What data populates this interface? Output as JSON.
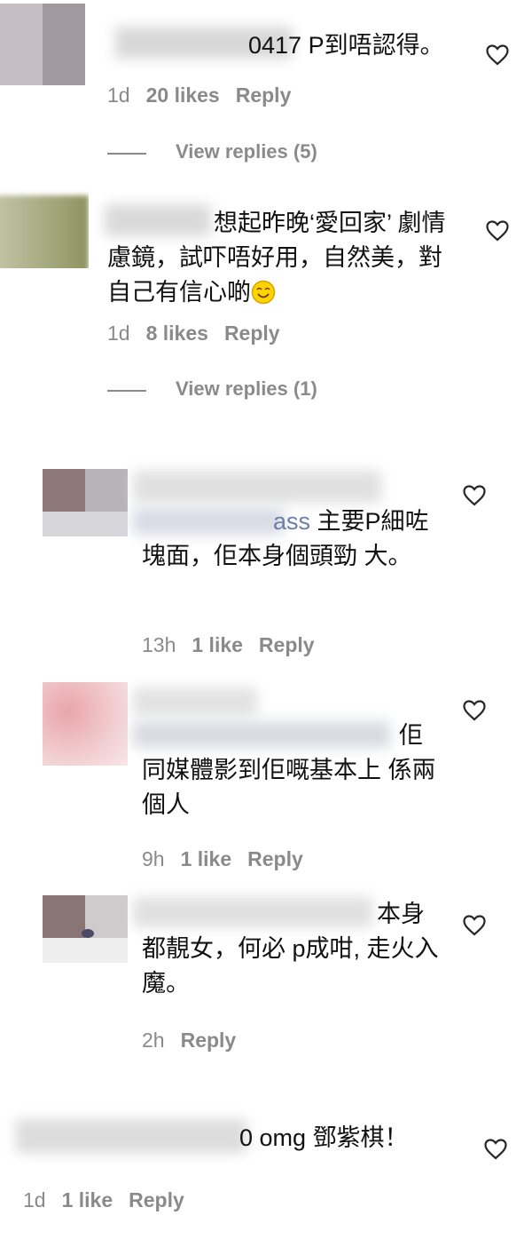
{
  "comments": [
    {
      "text_visible": "0417 P到唔認得。",
      "time": "1d",
      "likes": "20 likes",
      "reply": "Reply",
      "view_replies": "View replies (5)"
    },
    {
      "text_visible": "想起昨晚‘愛回家’ 劇情 慮鏡，試吓唔好用，自然美，對 自己有信心啲",
      "emoji": "smiling-face-icon",
      "time": "1d",
      "likes": "8 likes",
      "reply": "Reply",
      "view_replies": "View replies (1)"
    },
    {
      "text_visible": "主要P細咗 塊面，佢本身個頭勁 大。",
      "mention_tail": "ass",
      "time": "13h",
      "likes": "1 like",
      "reply": "Reply"
    },
    {
      "text_visible": "佢 同媒體影到佢嘅基本上 係兩個人",
      "time": "9h",
      "likes": "1 like",
      "reply": "Reply"
    },
    {
      "text_visible": "本身 都靚女，何必 p成咁, 走火入魔。",
      "time": "2h",
      "reply": "Reply"
    },
    {
      "text_visible": "0 omg 鄧紫棋！",
      "time": "1d",
      "likes": "1 like",
      "reply": "Reply"
    }
  ],
  "colors": {
    "meta": "#8a8a8a",
    "text": "#111111",
    "heart_stroke": "#262626"
  },
  "icons": {
    "like": "heart-outline-icon"
  }
}
